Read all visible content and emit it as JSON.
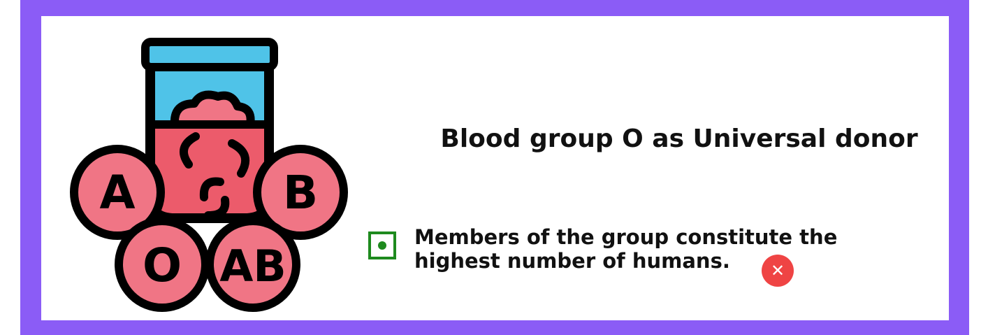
{
  "illustration": {
    "icon": "blood-test-tube-icon",
    "circle_labels": {
      "a": "A",
      "b": "B",
      "o": "O",
      "ab": "AB"
    },
    "colors": {
      "cap": "#4fc3e8",
      "blood": "#ec5b6b",
      "cell": "#f07585",
      "outline": "#000000"
    }
  },
  "question": {
    "title": "Blood group O as Universal donor"
  },
  "option": {
    "text_line1": "Members of the group constitute the",
    "text_line2": "highest number of humans.",
    "selected": true,
    "result_icon": "wrong-x-icon",
    "result_symbol": "✕"
  },
  "colors": {
    "frame": "#8b5cf6",
    "check": "#1e8a1e",
    "wrong": "#ef4444"
  }
}
